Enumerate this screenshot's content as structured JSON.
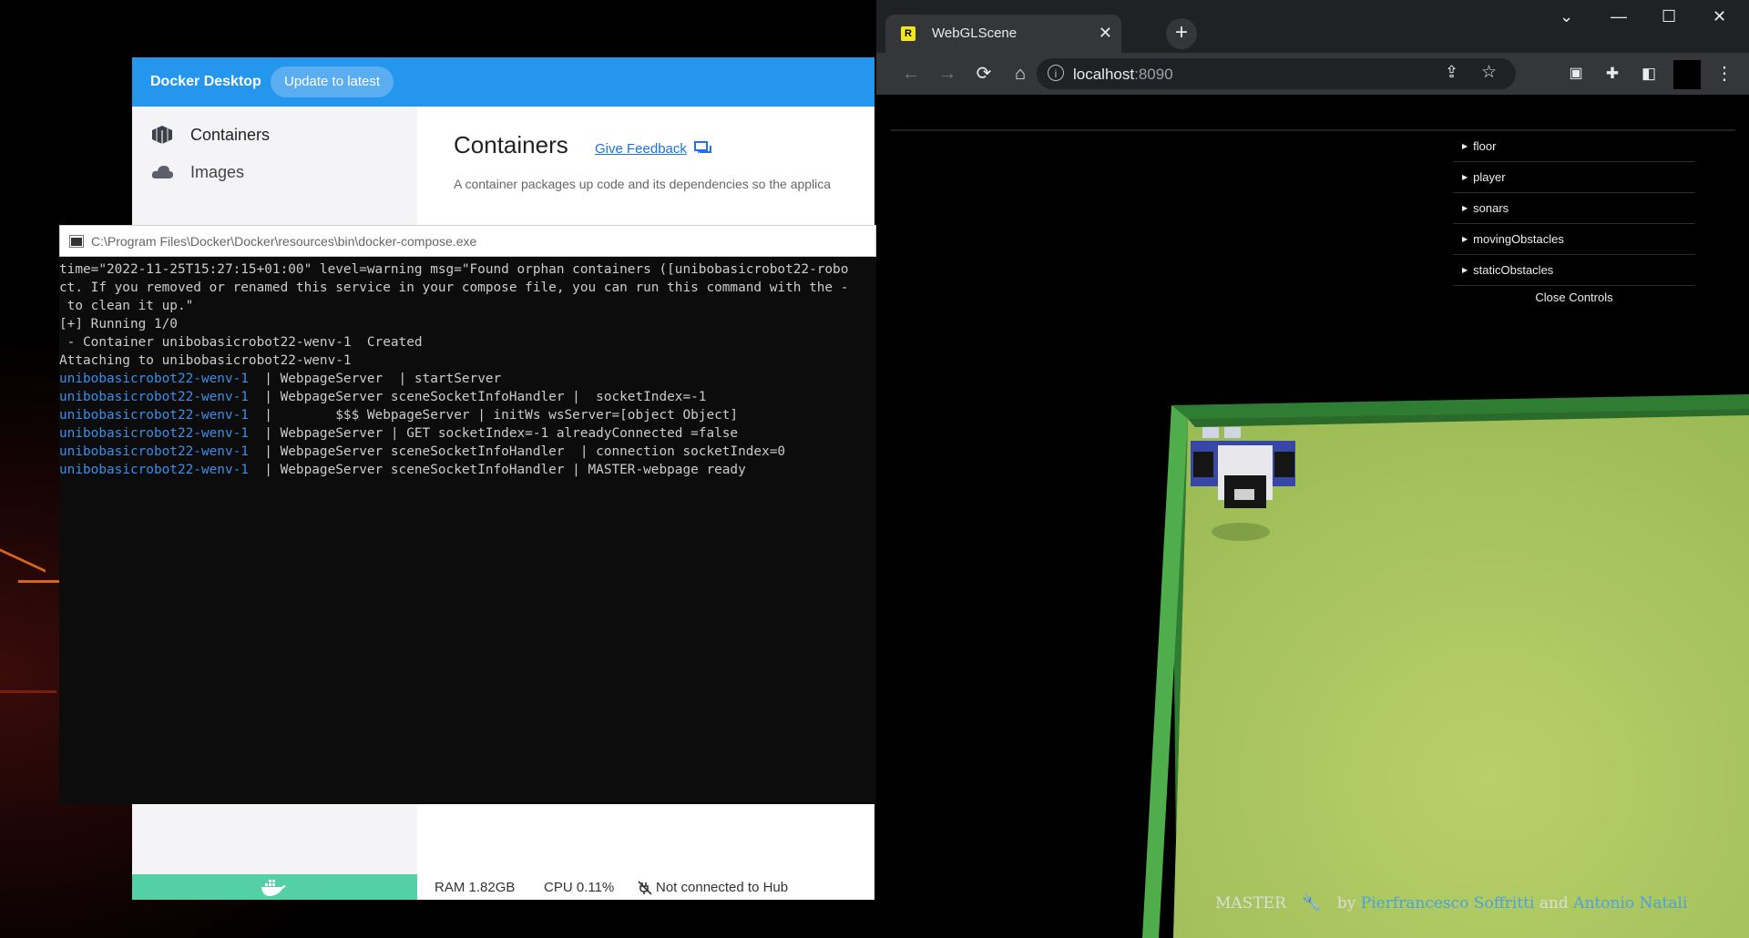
{
  "docker": {
    "app_title": "Docker Desktop",
    "update_button": "Update to latest",
    "sidebar": [
      {
        "label": "Containers",
        "icon": "containers-icon"
      },
      {
        "label": "Images",
        "icon": "images-icon"
      }
    ],
    "main_title": "Containers",
    "feedback_link": "Give Feedback",
    "description": "A container packages up code and its dependencies so the applica",
    "status": {
      "ram": "RAM 1.82GB",
      "cpu": "CPU 0.11%",
      "hub": "Not connected to Hub"
    }
  },
  "terminal": {
    "title": "C:\\Program Files\\Docker\\Docker\\resources\\bin\\docker-compose.exe",
    "lines": [
      {
        "svc": "",
        "text": "time=\"2022-11-25T15:27:15+01:00\" level=warning msg=\"Found orphan containers ([unibobasicrobot22-robo"
      },
      {
        "svc": "",
        "text": "ct. If you removed or renamed this service in your compose file, you can run this command with the -"
      },
      {
        "svc": "",
        "text": " to clean it up.\""
      },
      {
        "svc": "",
        "text": "[+] Running 1/0"
      },
      {
        "svc": "",
        "text": " - Container unibobasicrobot22-wenv-1  Created"
      },
      {
        "svc": "",
        "text": "Attaching to unibobasicrobot22-wenv-1"
      },
      {
        "svc": "unibobasicrobot22-wenv-1",
        "text": "  | WebpageServer  | startServer"
      },
      {
        "svc": "unibobasicrobot22-wenv-1",
        "text": "  | WebpageServer sceneSocketInfoHandler |  socketIndex=-1"
      },
      {
        "svc": "unibobasicrobot22-wenv-1",
        "text": "  |        $$$ WebpageServer | initWs wsServer=[object Object]"
      },
      {
        "svc": "unibobasicrobot22-wenv-1",
        "text": "  | WebpageServer | GET socketIndex=-1 alreadyConnected =false"
      },
      {
        "svc": "unibobasicrobot22-wenv-1",
        "text": "  | WebpageServer sceneSocketInfoHandler  | connection socketIndex=0"
      },
      {
        "svc": "unibobasicrobot22-wenv-1",
        "text": "  | WebpageServer sceneSocketInfoHandler | MASTER-webpage ready"
      }
    ]
  },
  "browser": {
    "tab_title": "WebGLScene",
    "favicon_letter": "R",
    "url_host": "localhost",
    "url_port": ":8090",
    "controls": [
      "floor",
      "player",
      "sonars",
      "movingObstacles",
      "staticObstacles"
    ],
    "close_controls": "Close Controls",
    "footer": {
      "master": "MASTER",
      "by": "by",
      "author1": "Pierfrancesco Soffritti",
      "and": "and",
      "author2": "Antonio Natali"
    }
  },
  "colors": {
    "docker_blue": "#2496ed",
    "docker_green_strip": "#54d0a6",
    "terminal_service": "#3b8eea",
    "floor_green": "#a7c45f",
    "wall_green": "#4fae4b"
  }
}
